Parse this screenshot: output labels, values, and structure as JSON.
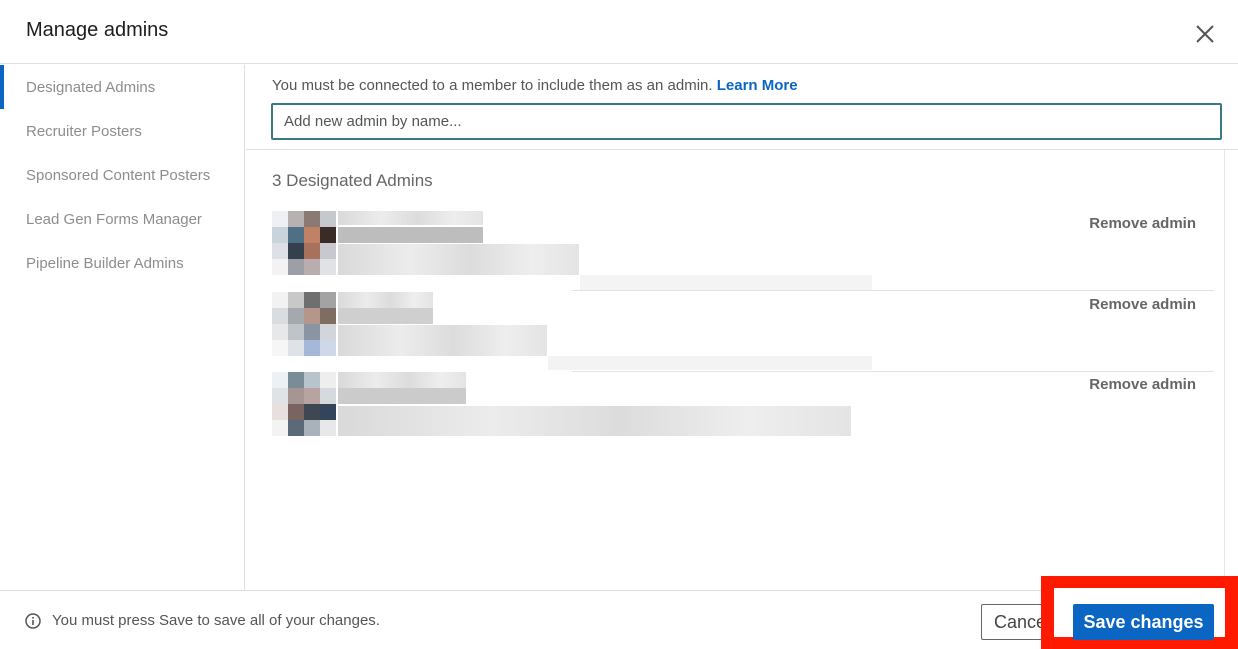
{
  "dialog": {
    "title": "Manage admins",
    "close_icon": "close-icon"
  },
  "sidebar": {
    "items": [
      {
        "label": "Designated Admins",
        "active": true
      },
      {
        "label": "Recruiter Posters"
      },
      {
        "label": "Sponsored Content Posters"
      },
      {
        "label": "Lead Gen Forms Manager"
      },
      {
        "label": "Pipeline Builder Admins"
      }
    ]
  },
  "main": {
    "hint_text": "You must be connected to a member to include them as an admin.",
    "learn_more": "Learn More",
    "search_placeholder": "Add new admin by name...",
    "count_label": "3 Designated Admins",
    "admins": [
      {
        "remove_label": "Remove admin"
      },
      {
        "remove_label": "Remove admin"
      },
      {
        "remove_label": "Remove admin"
      }
    ]
  },
  "footer": {
    "info_icon": "info-icon",
    "note": "You must press Save to save all of your changes.",
    "cancel_label": "Cancel",
    "save_label": "Save changes"
  },
  "colors": {
    "accent": "#0a66c2",
    "highlight": "#ff1a00",
    "search_border": "#3a7a85"
  }
}
